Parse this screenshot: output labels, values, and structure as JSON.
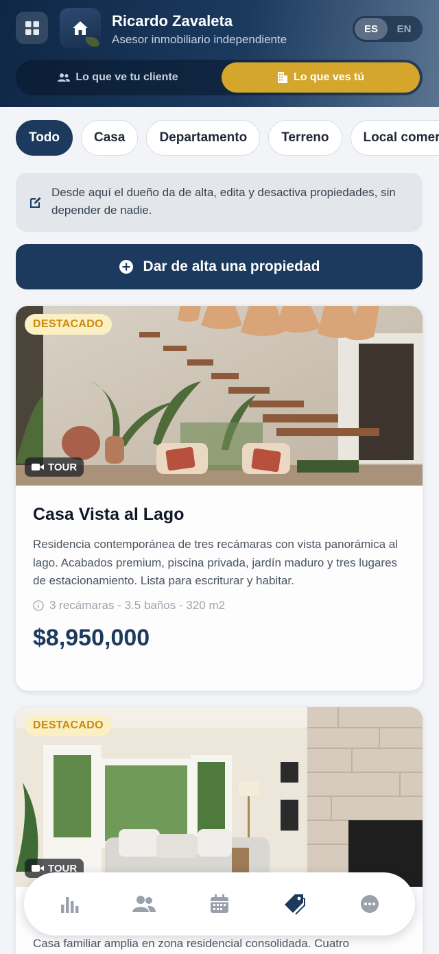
{
  "header": {
    "agent_name": "Ricardo Zavaleta",
    "agent_role": "Asesor inmobiliario independiente",
    "lang_options": [
      "ES",
      "EN"
    ],
    "lang_selected": "ES",
    "view_client_label": "Lo que ve tu cliente",
    "view_owner_label": "Lo que ves tú",
    "view_selected": "Lo que ves tú"
  },
  "filters": [
    "Todo",
    "Casa",
    "Departamento",
    "Terreno",
    "Local comercial"
  ],
  "filter_selected": "Todo",
  "info_text": "Desde aquí el dueño da de alta, edita y desactiva propiedades, sin depender de nadie.",
  "add_button_label": "Dar de alta una propiedad",
  "properties": [
    {
      "badge": "DESTACADO",
      "tour_label": "TOUR",
      "title": "Casa Vista al Lago",
      "description": "Residencia contemporánea de tres recámaras con vista panorámica al lago. Acabados premium, piscina privada, jardín maduro y tres lugares de estacionamiento. Lista para escriturar y habitar.",
      "meta": "3 recámaras - 3.5 baños - 320 m2",
      "price": "$8,950,000"
    },
    {
      "badge": "DESTACADO",
      "tour_label": "TOUR",
      "description": "Casa familiar amplia en zona residencial consolidada. Cuatro"
    }
  ],
  "bottom_nav": [
    {
      "icon": "chart-icon",
      "active": false
    },
    {
      "icon": "users-icon",
      "active": false
    },
    {
      "icon": "calendar-icon",
      "active": false
    },
    {
      "icon": "tag-icon",
      "active": true
    },
    {
      "icon": "more-icon",
      "active": false
    }
  ],
  "colors": {
    "navy": "#1b3a5e",
    "gold": "#d4a72c",
    "badge_bg": "#fbefc4",
    "badge_text": "#c98a0a"
  }
}
